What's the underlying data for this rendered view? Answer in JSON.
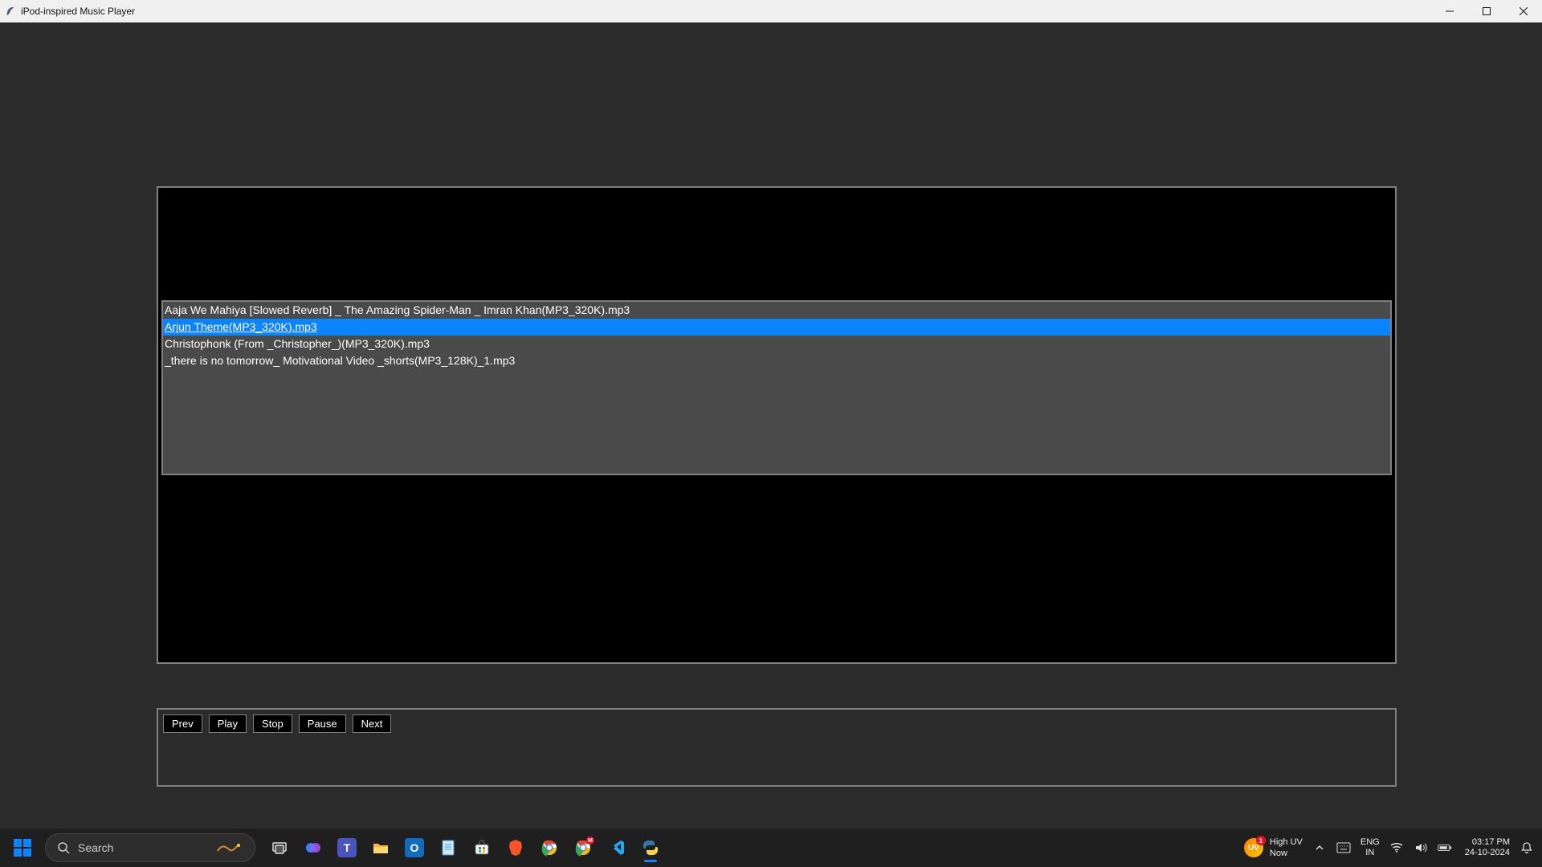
{
  "window": {
    "title": "iPod-inspired Music Player"
  },
  "playlist": {
    "items": [
      "Aaja We Mahiya [Slowed Reverb] _ The Amazing Spider-Man _ Imran Khan(MP3_320K).mp3",
      "Arjun Theme(MP3_320K).mp3",
      "Christophonk (From _Christopher_)(MP3_320K).mp3",
      "_there is no tomorrow_ Motivational Video _shorts(MP3_128K)_1.mp3"
    ],
    "selected_index": 1
  },
  "controls": {
    "prev": "Prev",
    "play": "Play",
    "stop": "Stop",
    "pause": "Pause",
    "next": "Next"
  },
  "taskbar": {
    "search_label": "Search",
    "weather": {
      "line1": "High UV",
      "line2": "Now",
      "badge": "UV"
    },
    "lang": {
      "line1": "ENG",
      "line2": "IN"
    },
    "clock": {
      "time": "03:17 PM",
      "date": "24-10-2024"
    }
  }
}
